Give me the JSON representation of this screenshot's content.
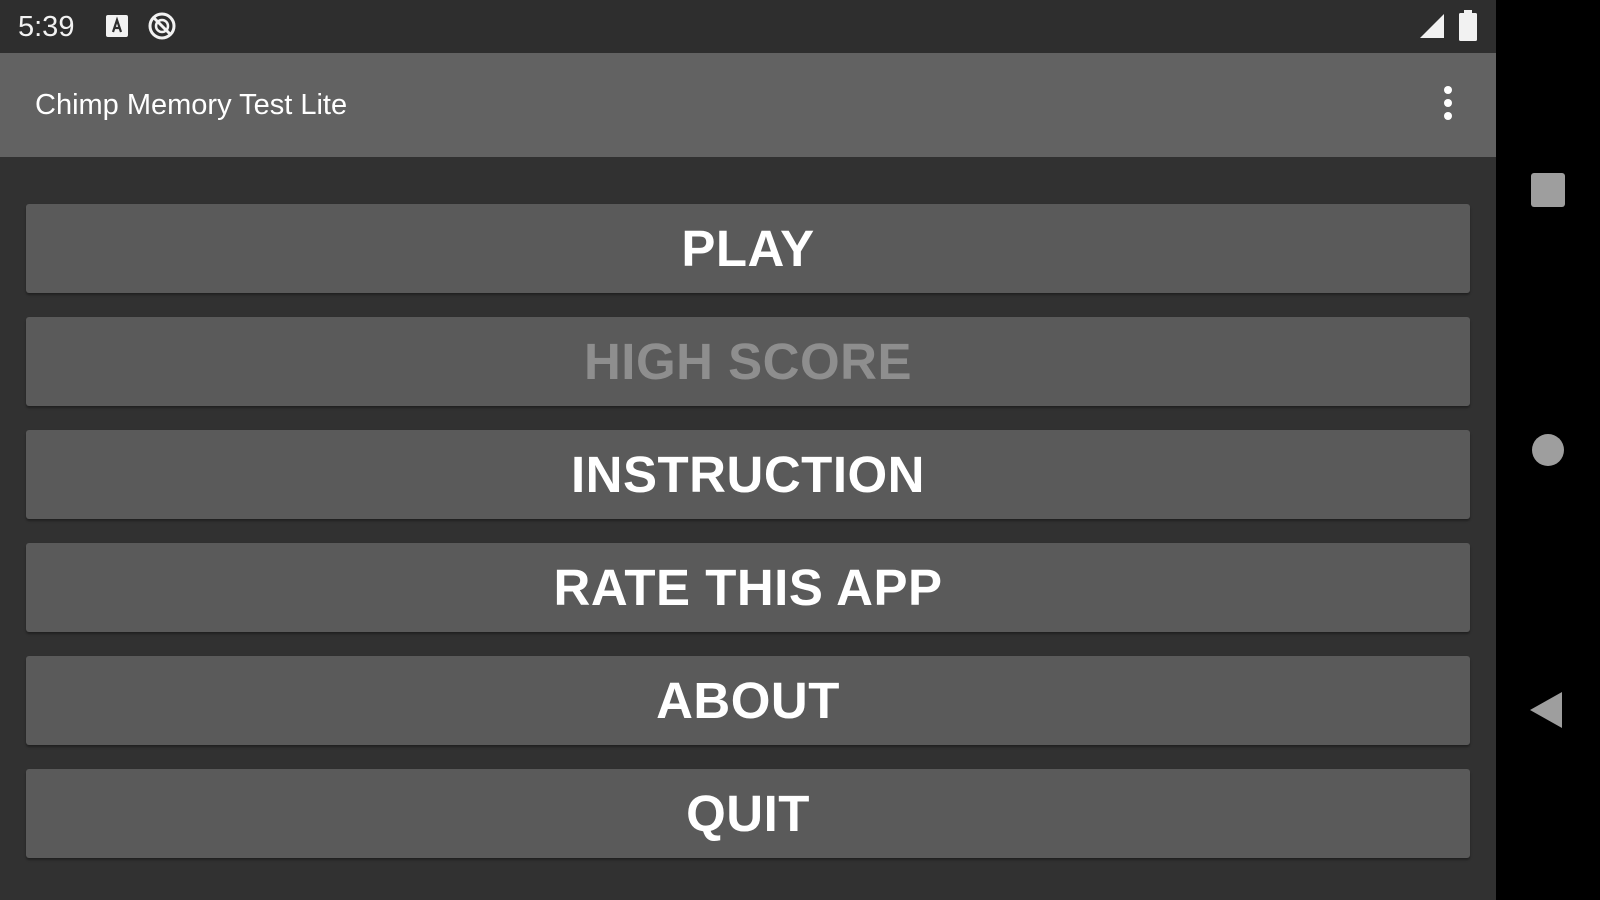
{
  "status_bar": {
    "time": "5:39",
    "icons": [
      "notification-a-icon",
      "do-not-disturb-icon",
      "cell-signal-icon",
      "battery-icon"
    ]
  },
  "app_bar": {
    "title": "Chimp Memory Test Lite",
    "overflow_icon": "more-vert-icon"
  },
  "menu": {
    "buttons": [
      {
        "label": "PLAY",
        "enabled": true
      },
      {
        "label": "HIGH SCORE",
        "enabled": false
      },
      {
        "label": "INSTRUCTION",
        "enabled": true
      },
      {
        "label": "RATE THIS APP",
        "enabled": true
      },
      {
        "label": "ABOUT",
        "enabled": true
      },
      {
        "label": "QUIT",
        "enabled": true
      }
    ]
  },
  "nav_bar": {
    "icons": [
      "recents-icon",
      "home-icon",
      "back-icon"
    ]
  },
  "colors": {
    "background": "#313131",
    "status_bar": "#2e2e2e",
    "app_bar": "#626262",
    "button": "#5a5a5a",
    "button_text": "#ffffff",
    "button_text_disabled": "#8e8e8e",
    "nav_bar": "#000000"
  }
}
